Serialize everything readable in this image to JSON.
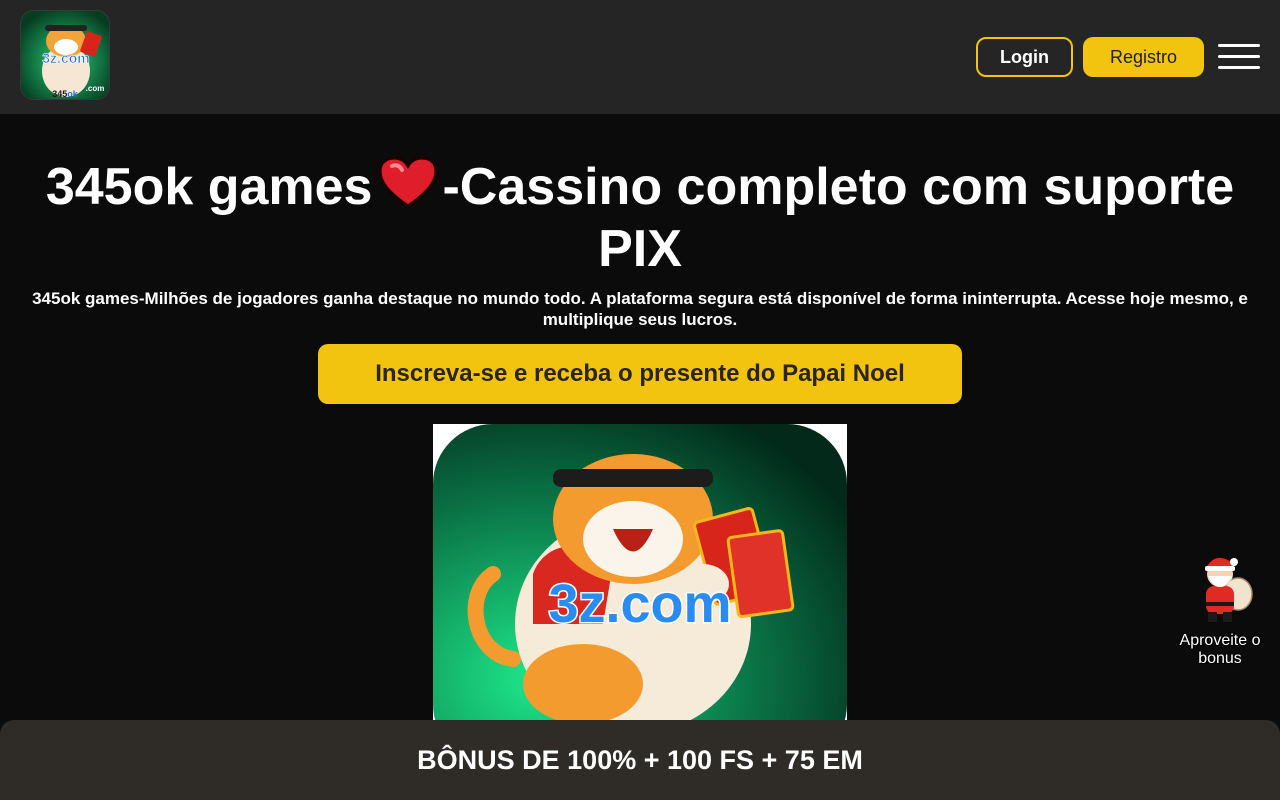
{
  "header": {
    "logo": {
      "text": "3z.com",
      "sub": "345ok",
      "suffix": ".com"
    },
    "login_label": "Login",
    "register_label": "Registro",
    "menu_icon": "hamburger-menu-icon"
  },
  "main": {
    "title_part1": "345ok games",
    "title_part2": "-Cassino completo com suporte PIX",
    "subtitle": "345ok games-Milhões de jogadores ganha destaque no mundo todo. A plataforma segura está disponível de forma ininterrupta. Acesse hoje mesmo, e multiplique seus lucros.",
    "cta_label": "Inscreva-se e receba o presente do Papai Noel",
    "hero_text": "3z.com"
  },
  "floating": {
    "santa_label": "Aproveite o bonus"
  },
  "bottom_bar": {
    "label": "BÔNUS DE 100% + 100 FS + 75 EM"
  },
  "colors": {
    "accent": "#f2c40f",
    "header_bg": "#252525",
    "page_bg": "#0b0b0b",
    "bottom_bar_bg": "#2f2b26"
  }
}
